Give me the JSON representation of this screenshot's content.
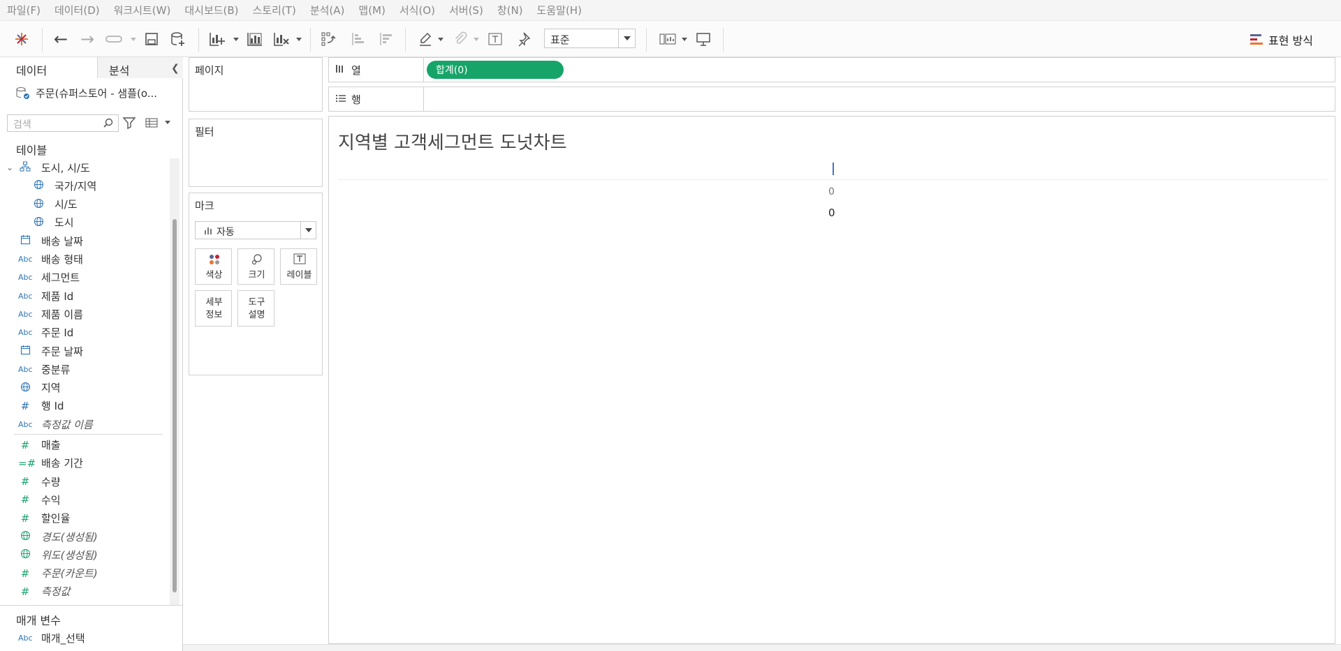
{
  "menu": [
    "파일(F)",
    "데이터(D)",
    "워크시트(W)",
    "대시보드(B)",
    "스토리(T)",
    "분석(A)",
    "맵(M)",
    "서식(O)",
    "서버(S)",
    "창(N)",
    "도움말(H)"
  ],
  "toolbar": {
    "fit_value": "표준",
    "show_me_label": "표현 방식",
    "icons": [
      "tableau-logo-icon",
      "undo-icon",
      "redo-icon",
      "replay-icon",
      "save-icon",
      "new-datasource-icon",
      "new-worksheet-icon",
      "duplicate-icon",
      "clear-sheet-icon",
      "swap-icon",
      "sort-asc-icon",
      "sort-desc-icon",
      "highlight-icon",
      "group-icon",
      "text-label-icon",
      "pin-icon",
      "show-cards-icon",
      "presentation-icon"
    ]
  },
  "datapane": {
    "tab_data": "데이터",
    "tab_analysis": "분석",
    "datasource": "주문(슈퍼스토어 - 샘플(o...",
    "search_placeholder": "검색",
    "tables_heading": "테이블",
    "fields": [
      {
        "label": "도시, 시/도",
        "icon": "hierarchy-icon",
        "type": "hierarchy"
      },
      {
        "label": "국가/지역",
        "icon": "globe-icon",
        "type": "geo-child"
      },
      {
        "label": "시/도",
        "icon": "globe-icon",
        "type": "geo-child"
      },
      {
        "label": "도시",
        "icon": "globe-icon",
        "type": "geo-child"
      },
      {
        "label": "배송 날짜",
        "icon": "calendar-icon",
        "type": "dim"
      },
      {
        "label": "배송 형태",
        "icon": "Abc",
        "type": "dim"
      },
      {
        "label": "세그먼트",
        "icon": "Abc",
        "type": "dim"
      },
      {
        "label": "제품 Id",
        "icon": "Abc",
        "type": "dim"
      },
      {
        "label": "제품 이름",
        "icon": "Abc",
        "type": "dim"
      },
      {
        "label": "주문 Id",
        "icon": "Abc",
        "type": "dim"
      },
      {
        "label": "주문 날짜",
        "icon": "calendar-icon",
        "type": "dim"
      },
      {
        "label": "중분류",
        "icon": "Abc",
        "type": "dim"
      },
      {
        "label": "지역",
        "icon": "globe-icon",
        "type": "dim"
      },
      {
        "label": "행 Id",
        "icon": "#",
        "type": "dim-num"
      },
      {
        "label": "측정값 이름",
        "icon": "Abc",
        "type": "dim-italic"
      },
      {
        "label": "매출",
        "icon": "#",
        "type": "measure"
      },
      {
        "label": "배송 기간",
        "icon": "=#",
        "type": "measure"
      },
      {
        "label": "수량",
        "icon": "#",
        "type": "measure"
      },
      {
        "label": "수익",
        "icon": "#",
        "type": "measure"
      },
      {
        "label": "할인율",
        "icon": "#",
        "type": "measure"
      },
      {
        "label": "경도(생성됨)",
        "icon": "globe-icon",
        "type": "measure-italic"
      },
      {
        "label": "위도(생성됨)",
        "icon": "globe-icon",
        "type": "measure-italic"
      },
      {
        "label": "주문(카운트)",
        "icon": "#",
        "type": "measure-italic"
      },
      {
        "label": "측정값",
        "icon": "#",
        "type": "measure-italic"
      }
    ],
    "params_heading": "매개 변수",
    "params": [
      {
        "label": "매개_선택",
        "icon": "Abc"
      }
    ]
  },
  "cards": {
    "pages": "페이지",
    "filters": "필터",
    "marks": "마크",
    "marks_type": "자동",
    "mark_buttons": {
      "color": "색상",
      "size": "크기",
      "label": "레이블",
      "detail_1": "세부",
      "detail_2": "정보",
      "tooltip_1": "도구",
      "tooltip_2": "설명"
    }
  },
  "shelves": {
    "columns": "열",
    "rows": "행",
    "column_pill": "합계(0)"
  },
  "sheet": {
    "title": "지역별 고객세그먼트 도넛차트",
    "axis_tick": "0",
    "mark_label": "0"
  },
  "colors": {
    "pill": "#16a469",
    "measure_icon": "#1ea36e",
    "dim_icon": "#2f75b5"
  }
}
